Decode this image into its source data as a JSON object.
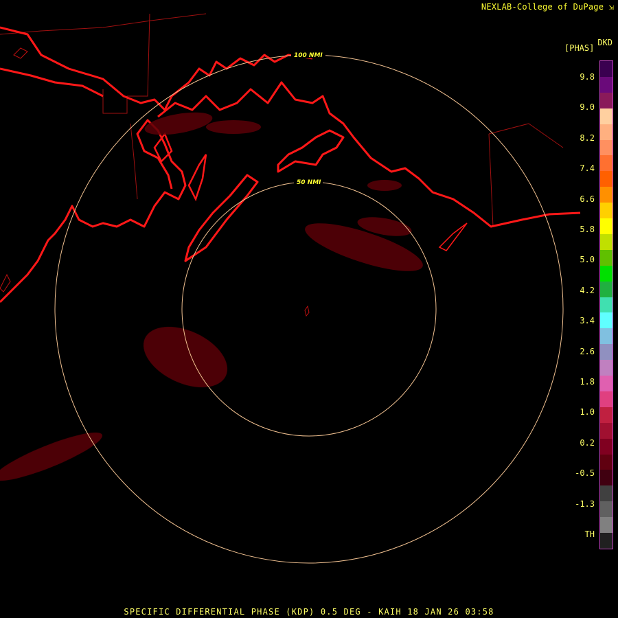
{
  "credit": "NEXLAB-College of DuPage",
  "credit_icon": "expand-arrow-icon",
  "product": {
    "code": "DKD",
    "units": "[PHAS]"
  },
  "ring_labels": [
    "100 NMI",
    "50 NMI"
  ],
  "legend": {
    "ticks": [
      "9.8",
      "9.0",
      "8.2",
      "7.4",
      "6.6",
      "5.8",
      "5.0",
      "4.2",
      "3.4",
      "2.6",
      "1.8",
      "1.0",
      "0.2",
      "-0.5",
      "-1.3",
      "TH"
    ],
    "colors": [
      "#3a0050",
      "#6a0a7a",
      "#8a1a5a",
      "#ffd0a0",
      "#ffb080",
      "#ff9060",
      "#ff7030",
      "#ff6000",
      "#ff9000",
      "#ffd000",
      "#ffff00",
      "#c0e000",
      "#60c000",
      "#00e000",
      "#20b040",
      "#40e0b0",
      "#60ffff",
      "#80c0e0",
      "#9090c0",
      "#c080c0",
      "#e060b0",
      "#e04080",
      "#c02040",
      "#a01030",
      "#800020",
      "#600010",
      "#400010",
      "#404040",
      "#606060",
      "#808080",
      "#202020"
    ]
  },
  "footer": "SPECIFIC DIFFERENTIAL PHASE (KDP) 0.5 DEG - KAIH 18 JAN 26 03:58"
}
